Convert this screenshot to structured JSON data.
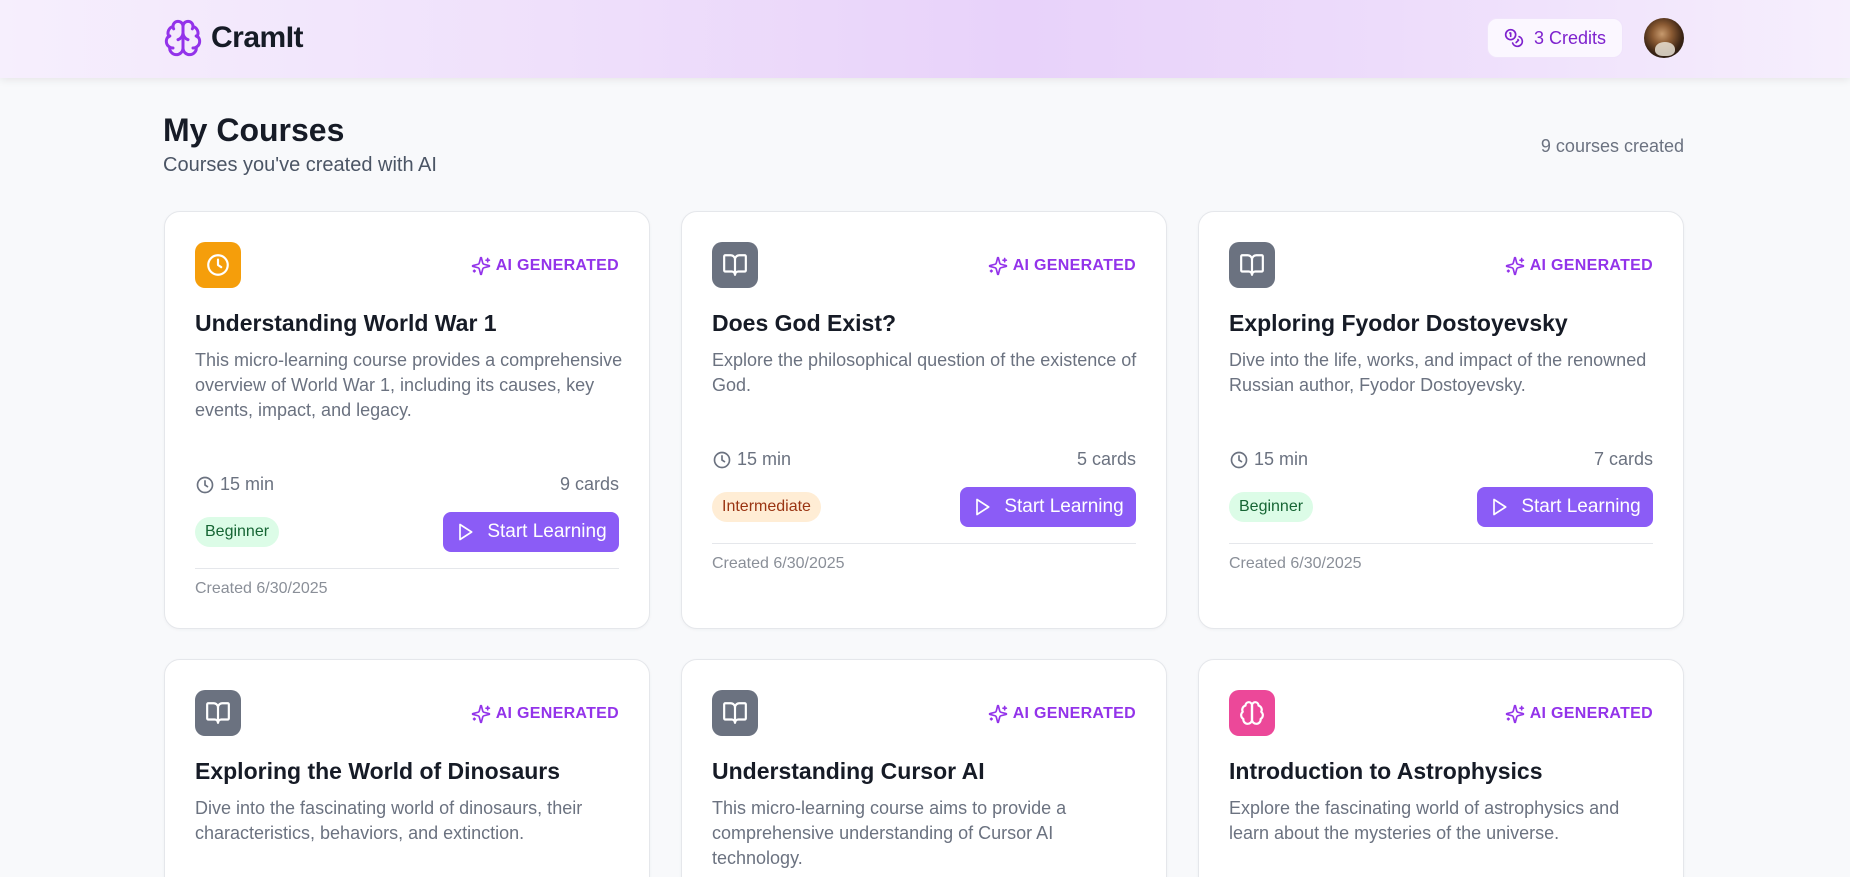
{
  "app": {
    "name": "CramIt",
    "credits_label": "3 Credits"
  },
  "page": {
    "title": "My Courses",
    "subtitle": "Courses you've created with AI",
    "count_label": "9 courses created"
  },
  "colors": {
    "accent": "#8b5cf6",
    "ai_tag": "#9333ea",
    "icon_orange": "#f59e0b",
    "icon_gray": "#6b7280",
    "icon_pink": "#ec4899"
  },
  "courses": [
    {
      "icon": "clock-icon",
      "icon_color": "#f59e0b",
      "ai_label": "AI GENERATED",
      "title": "Understanding World War 1",
      "description": "This micro-learning course provides a comprehensive overview of World War 1, including its causes, key events, impact, and legacy.",
      "duration": "15 min",
      "cards": "9 cards",
      "level": "Beginner",
      "button": "Start Learning",
      "created": "Created 6/30/2025"
    },
    {
      "icon": "book-icon",
      "icon_color": "#6b7280",
      "ai_label": "AI GENERATED",
      "title": "Does God Exist?",
      "description": "Explore the philosophical question of the existence of God.",
      "duration": "15 min",
      "cards": "5 cards",
      "level": "Intermediate",
      "button": "Start Learning",
      "created": "Created 6/30/2025"
    },
    {
      "icon": "book-icon",
      "icon_color": "#6b7280",
      "ai_label": "AI GENERATED",
      "title": "Exploring Fyodor Dostoyevsky",
      "description": "Dive into the life, works, and impact of the renowned Russian author, Fyodor Dostoyevsky.",
      "duration": "15 min",
      "cards": "7 cards",
      "level": "Beginner",
      "button": "Start Learning",
      "created": "Created 6/30/2025"
    },
    {
      "icon": "book-icon",
      "icon_color": "#6b7280",
      "ai_label": "AI GENERATED",
      "title": "Exploring the World of Dinosaurs",
      "description": "Dive into the fascinating world of dinosaurs, their characteristics, behaviors, and extinction."
    },
    {
      "icon": "book-icon",
      "icon_color": "#6b7280",
      "ai_label": "AI GENERATED",
      "title": "Understanding Cursor AI",
      "description": "This micro-learning course aims to provide a comprehensive understanding of Cursor AI technology."
    },
    {
      "icon": "brain-icon",
      "icon_color": "#ec4899",
      "ai_label": "AI GENERATED",
      "title": "Introduction to Astrophysics",
      "description": "Explore the fascinating world of astrophysics and learn about the mysteries of the universe."
    }
  ]
}
